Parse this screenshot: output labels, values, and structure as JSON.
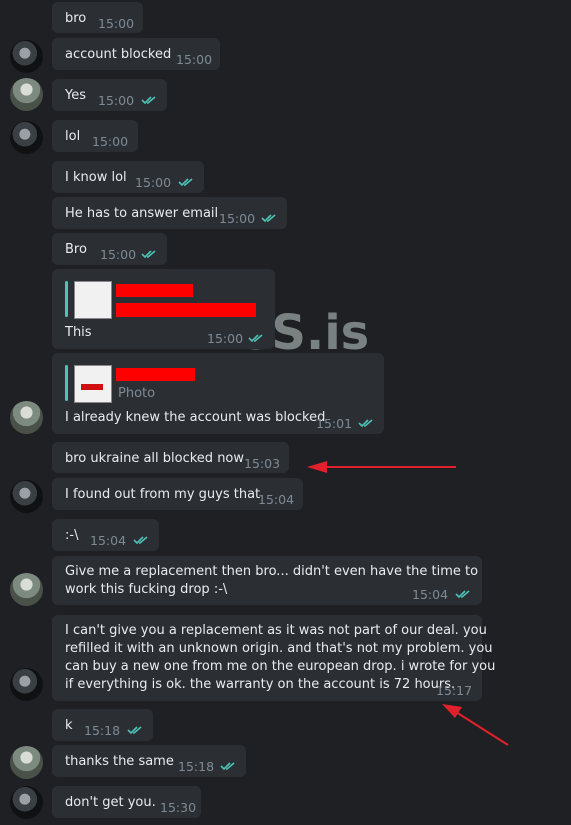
{
  "messages": [
    {
      "text": "bro",
      "time": "15:00"
    },
    {
      "text": "account blocked",
      "time": "15:00"
    },
    {
      "text": "Yes",
      "time": "15:00"
    },
    {
      "text": "lol",
      "time": "15:00"
    },
    {
      "text": "I know lol",
      "time": "15:00"
    },
    {
      "text": "He has to answer email",
      "time": "15:00"
    },
    {
      "text": "Bro",
      "time": "15:00"
    },
    {
      "text": "This",
      "time": "15:00"
    },
    {
      "text": "I already knew the account was blocked",
      "time": "15:01",
      "reply_label": "Photo"
    },
    {
      "text": "bro ukraine all blocked now",
      "time": "15:03"
    },
    {
      "text": "I found out from my guys that",
      "time": "15:04"
    },
    {
      "text": ":-\\",
      "time": "15:04"
    },
    {
      "lines": [
        "Give me a replacement then bro... didn't even have the time to",
        "work this fucking drop :-\\"
      ],
      "time": "15:04"
    },
    {
      "lines": [
        "I can't give you a replacement as it was not part of our deal. you",
        "refilled it with an unknown origin. and that's not my problem. you",
        "can buy a new one from me on the european drop. i wrote for you",
        "if everything is ok. the warranty on the account is 72 hours."
      ],
      "time": "15:17"
    },
    {
      "text": "k",
      "time": "15:18"
    },
    {
      "text": "thanks the same",
      "time": "15:18"
    },
    {
      "text": "don't get you.",
      "time": "15:30"
    }
  ],
  "watermark": "XSS.is",
  "colors": {
    "background": "#1e2024",
    "bubble": "#2b2f33",
    "read_tick": "#4ec3b8",
    "arrow": "#e0202a"
  }
}
